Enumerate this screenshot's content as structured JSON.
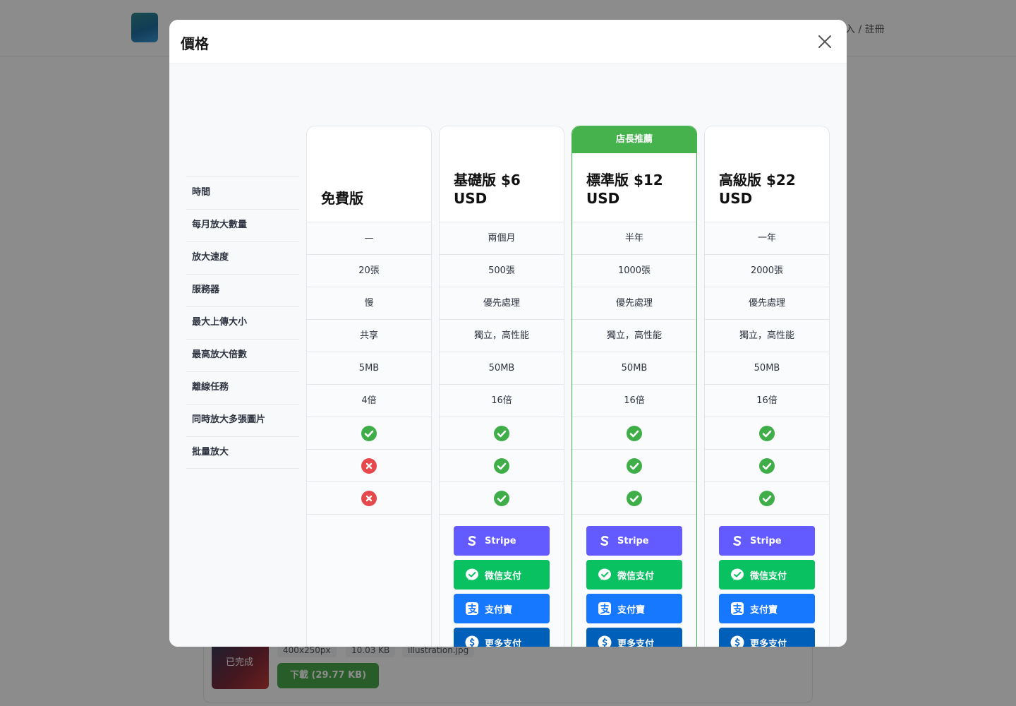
{
  "background": {
    "login_text": "入 / 註冊",
    "thumb_status": "已完成",
    "chips": [
      "400x250px",
      "10.03 KB",
      "illustration.jpg"
    ],
    "download_label": "下載 (29.77 KB)"
  },
  "modal": {
    "title": "價格",
    "close_icon": "close-icon"
  },
  "features": [
    "時間",
    "每月放大數量",
    "放大速度",
    "服務器",
    "最大上傳大小",
    "最高放大倍數",
    "離線任務",
    "同時放大多張圖片",
    "批量放大"
  ],
  "recommend_badge": "店長推薦",
  "plans": [
    {
      "title": "免費版",
      "recommended": false,
      "values": [
        "—",
        "20張",
        "慢",
        "共享",
        "5MB",
        "4倍",
        "check",
        "cross",
        "cross"
      ],
      "payments": []
    },
    {
      "title": "基礎版 $6\nUSD",
      "recommended": false,
      "values": [
        "兩個月",
        "500張",
        "優先處理",
        "獨立，高性能",
        "50MB",
        "16倍",
        "check",
        "check",
        "check"
      ],
      "payments": [
        "stripe",
        "wechat",
        "alipay",
        "more"
      ]
    },
    {
      "title": "標準版 $12\nUSD",
      "recommended": true,
      "values": [
        "半年",
        "1000張",
        "優先處理",
        "獨立，高性能",
        "50MB",
        "16倍",
        "check",
        "check",
        "check"
      ],
      "payments": [
        "stripe",
        "wechat",
        "alipay",
        "more"
      ]
    },
    {
      "title": "高級版 $22\nUSD",
      "recommended": false,
      "values": [
        "一年",
        "2000張",
        "優先處理",
        "獨立，高性能",
        "50MB",
        "16倍",
        "check",
        "check",
        "check"
      ],
      "payments": [
        "stripe",
        "wechat",
        "alipay",
        "more"
      ]
    }
  ],
  "payment_labels": {
    "stripe": "Stripe",
    "wechat": "微信支付",
    "alipay": "支付寶",
    "more": "更多支付"
  },
  "colors": {
    "check": "#3fae49",
    "cross": "#e5484d",
    "recommended": "#45b24e",
    "stripe": "#635bff",
    "wechat": "#09c160",
    "alipay": "#1677ff",
    "more": "#005fb8"
  }
}
